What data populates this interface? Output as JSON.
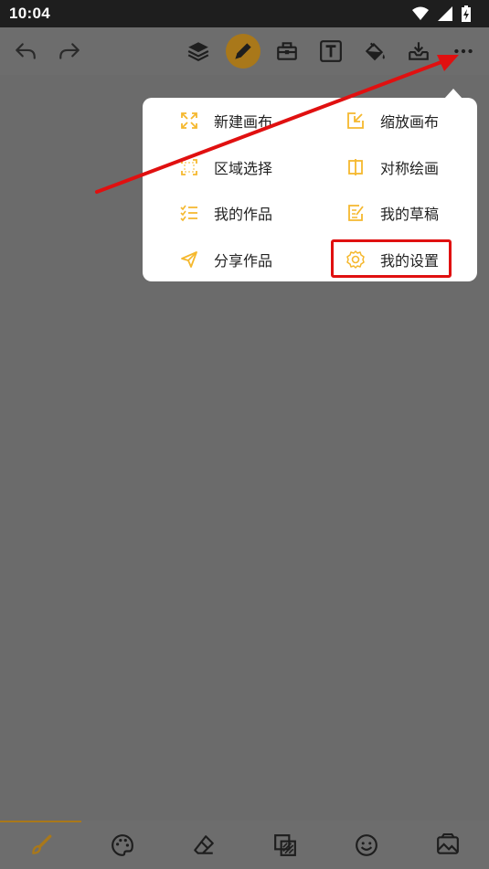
{
  "status": {
    "time": "10:04"
  },
  "menu": {
    "items": [
      {
        "label": "新建画布",
        "icon": "expand-icon"
      },
      {
        "label": "缩放画布",
        "icon": "resize-icon"
      },
      {
        "label": "区域选择",
        "icon": "select-area-icon"
      },
      {
        "label": "对称绘画",
        "icon": "symmetry-icon"
      },
      {
        "label": "我的作品",
        "icon": "list-check-icon"
      },
      {
        "label": "我的草稿",
        "icon": "draft-edit-icon"
      },
      {
        "label": "分享作品",
        "icon": "share-send-icon"
      },
      {
        "label": "我的设置",
        "icon": "settings-gear-icon"
      }
    ]
  },
  "colors": {
    "accent": "#f5b82e",
    "highlight": "#e01010",
    "active_tool": "#a9781a",
    "overlay": "#6b6b6b"
  }
}
